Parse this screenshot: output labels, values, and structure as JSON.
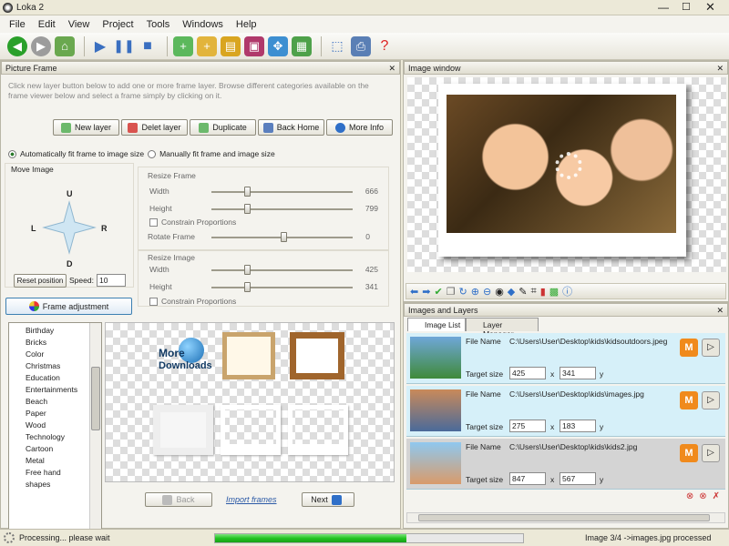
{
  "window": {
    "title": "Loka 2"
  },
  "menu": [
    "File",
    "Edit",
    "View",
    "Project",
    "Tools",
    "Windows",
    "Help"
  ],
  "picture_frame": {
    "header": "Picture Frame",
    "instructions": "Click new layer button below to add one or more frame layer. Browse different categories available on the frame viewer below and select a frame simply by clicking on it.",
    "buttons": {
      "new_layer": "New layer",
      "delete_layer": "Delet layer",
      "duplicate": "Duplicate",
      "back_home": "Back Home",
      "more_info": "More Info"
    },
    "fit_auto": "Automatically fit frame to image size",
    "fit_manual": "Manually fit frame and image size",
    "move_image": "Move Image",
    "dirs": {
      "u": "U",
      "d": "D",
      "l": "L",
      "r": "R"
    },
    "reset_position": "Reset position",
    "speed_label": "Speed:",
    "speed_value": "10",
    "frame_adjustment": "Frame adjustment",
    "resize_frame": {
      "title": "Resize Frame",
      "width_label": "Width",
      "width_value": "666",
      "height_label": "Height",
      "height_value": "799",
      "constrain": "Constrain Proportions"
    },
    "rotate": {
      "label": "Rotate Frame",
      "value": "0"
    },
    "resize_image": {
      "title": "Resize Image",
      "width_label": "Width",
      "width_value": "425",
      "height_label": "Height",
      "height_value": "341",
      "constrain": "Constrain Proportions"
    },
    "categories": [
      "Birthday",
      "Bricks",
      "Color",
      "Christmas",
      "Education",
      "Entertainments",
      "Beach",
      "Paper",
      "Wood",
      "Technology",
      "Cartoon",
      "Metal",
      "Free hand",
      "shapes"
    ],
    "more_downloads": [
      "More",
      "Downloads"
    ],
    "nav": {
      "back": "Back",
      "import": "Import frames",
      "next": "Next"
    }
  },
  "image_window": {
    "header": "Image window"
  },
  "images_layers": {
    "header": "Images and Layers",
    "tabs": {
      "image_list": "Image List",
      "layer_manager": "Layer Manager"
    },
    "file_label": "File Name",
    "target_label": "Target size",
    "x_sep": "x",
    "y_label": "y",
    "rows": [
      {
        "file": "C:\\Users\\User\\Desktop\\kids\\kidsoutdoors.jpeg",
        "w": "425",
        "h": "341"
      },
      {
        "file": "C:\\Users\\User\\Desktop\\kids\\images.jpg",
        "w": "275",
        "h": "183"
      },
      {
        "file": "C:\\Users\\User\\Desktop\\kids\\kids2.jpg",
        "w": "847",
        "h": "567"
      }
    ]
  },
  "status": {
    "left": "Processing... please wait",
    "right": "Image 3/4 ->images.jpg processed",
    "progress": 0.62
  },
  "colors": {
    "accent": "#2f8fd6",
    "progress": "#22c422"
  }
}
